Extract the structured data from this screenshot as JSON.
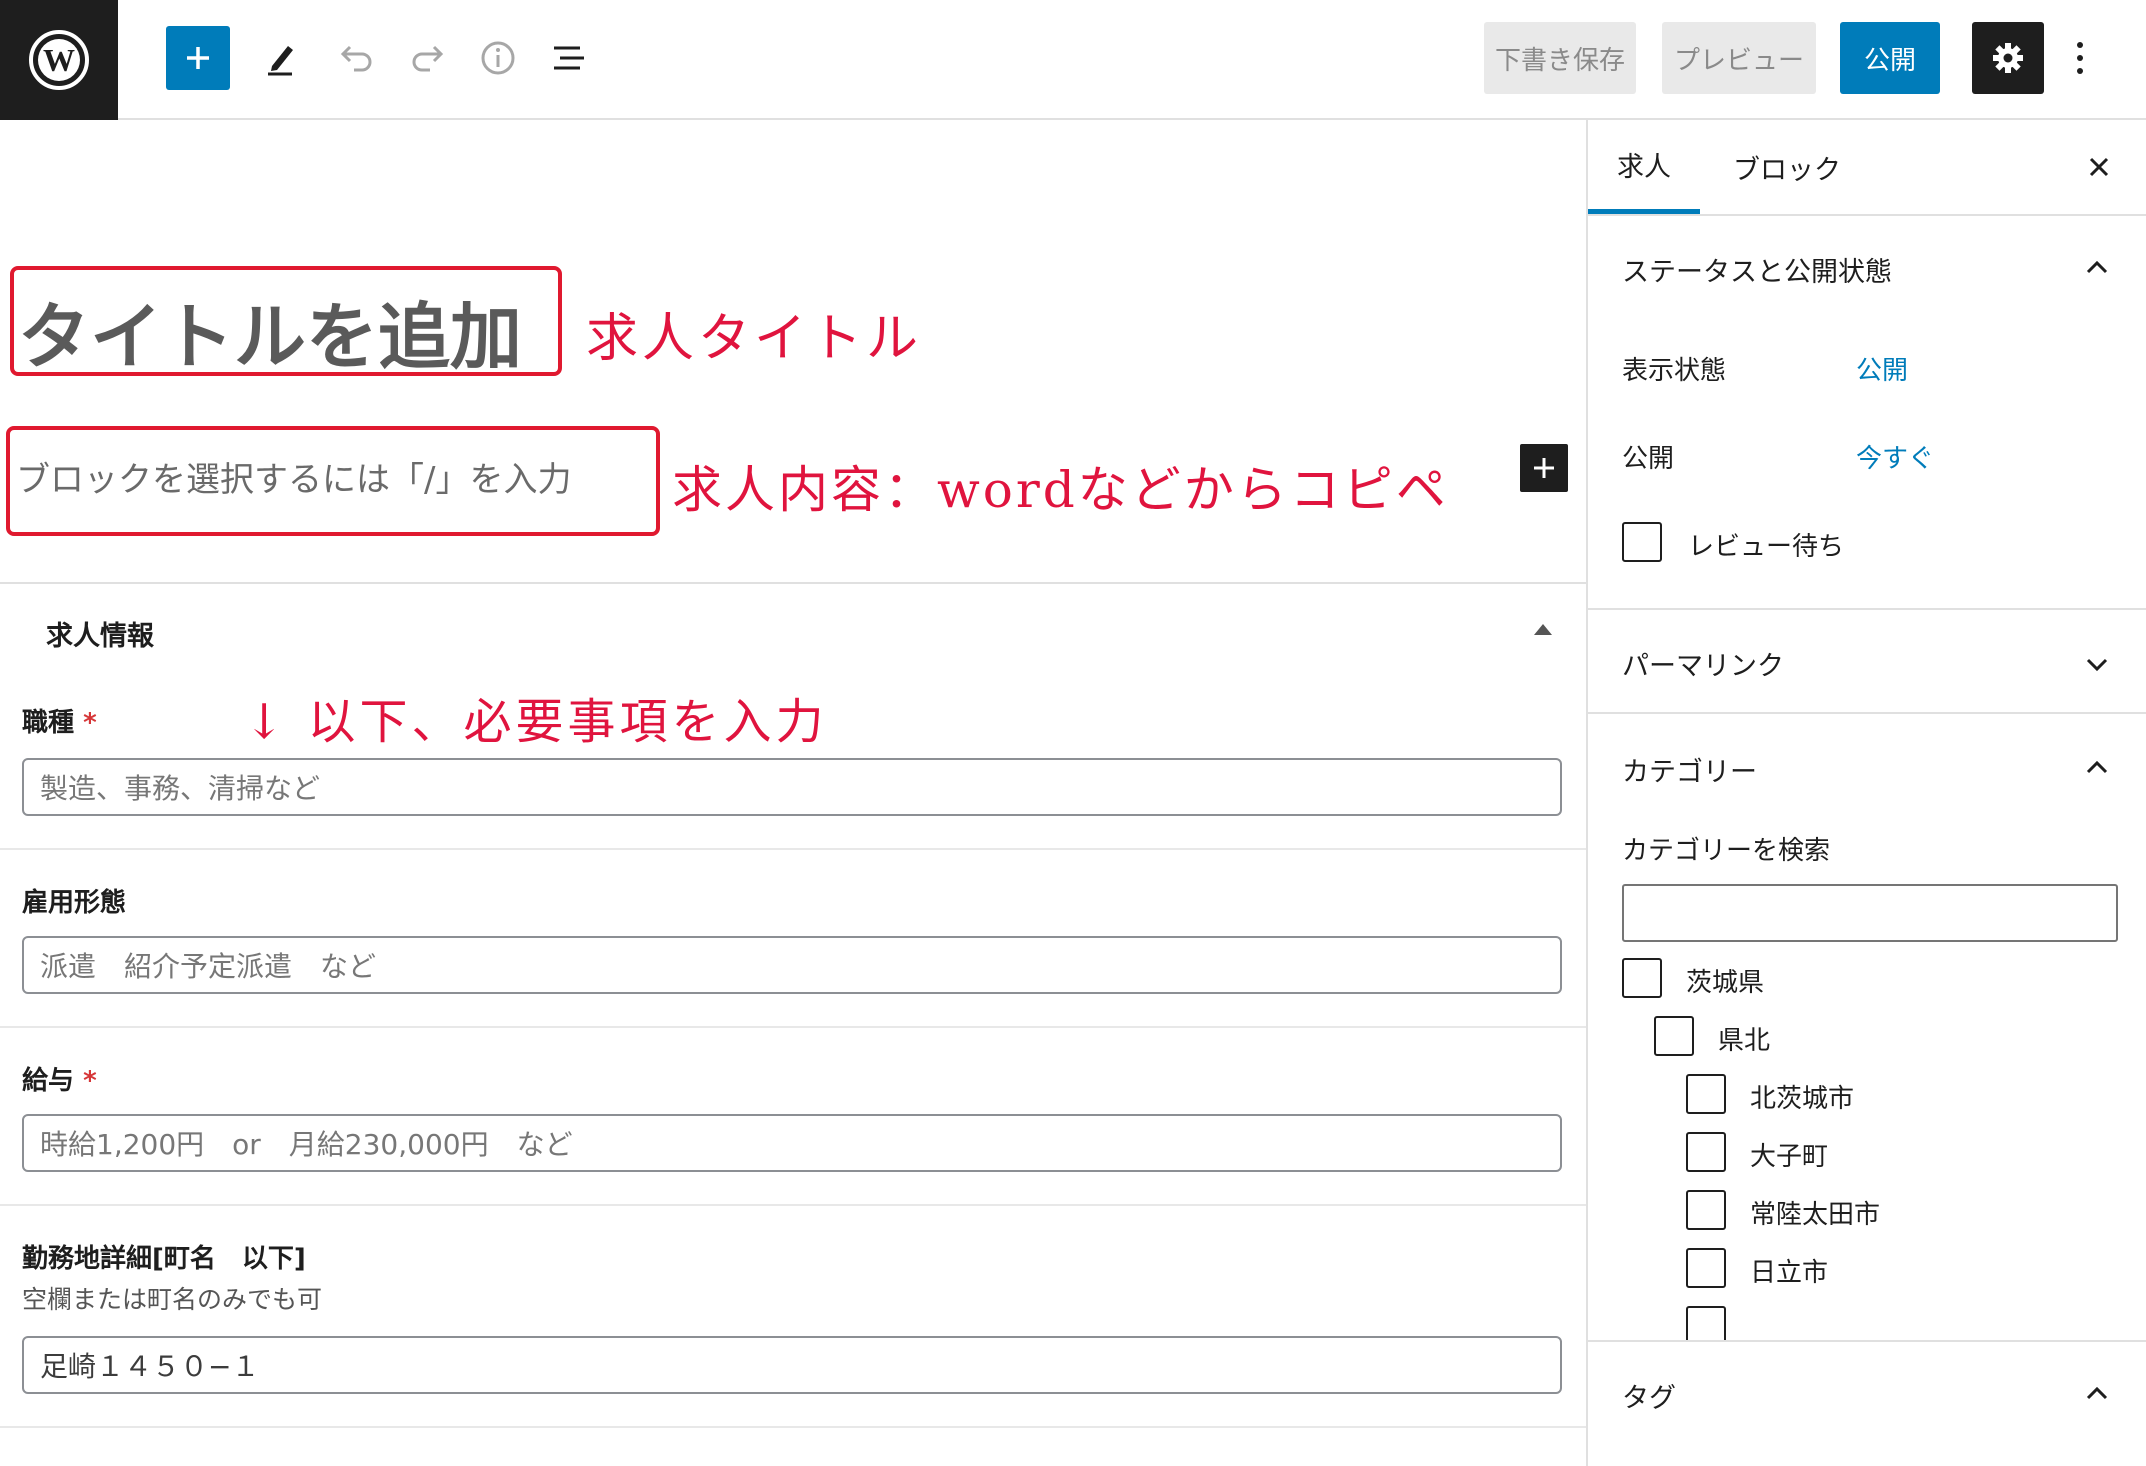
{
  "toolbar": {
    "save_draft_label": "下書き保存",
    "preview_label": "プレビュー",
    "publish_label": "公開",
    "icons": [
      "wordpress-logo",
      "plus-icon",
      "pencil-icon",
      "undo-icon",
      "redo-icon",
      "info-icon",
      "list-view-icon",
      "gear-icon",
      "more-vertical-icon"
    ]
  },
  "editor": {
    "title_placeholder": "タイトルを追加",
    "block_placeholder": "ブロックを選択するには「/」を入力",
    "annotations": {
      "title": "求人タイトル",
      "content": "求人内容：wordなどからコピペ",
      "fields": "↓ 以下、必要事項を入力"
    }
  },
  "metabox": {
    "title": "求人情報",
    "fields": [
      {
        "label": "職種",
        "required": "*",
        "placeholder": "製造、事務、清掃など"
      },
      {
        "label": "雇用形態",
        "placeholder": "派遣　紹介予定派遣　など"
      },
      {
        "label": "給与",
        "required": "*",
        "placeholder": "時給1,200円　or　月給230,000円　など"
      },
      {
        "label": "勤務地詳細[町名　以下]",
        "description": "空欄または町名のみでも可",
        "value": "足崎１４５０−１"
      }
    ]
  },
  "sidebar": {
    "tabs": [
      "求人",
      "ブロック"
    ],
    "status_section": {
      "title": "ステータスと公開状態",
      "visibility_label": "表示状態",
      "visibility_value": "公開",
      "publish_label": "公開",
      "publish_value": "今すぐ",
      "pending_review_label": "レビュー待ち"
    },
    "permalink_title": "パーマリンク",
    "category_section": {
      "title": "カテゴリー",
      "search_label": "カテゴリーを検索",
      "search_value": "",
      "items": [
        "茨城県",
        "県北",
        "北茨城市",
        "大子町",
        "常陸太田市",
        "日立市"
      ]
    },
    "tags_title": "タグ"
  },
  "colors": {
    "accent": "#007cba",
    "annotation": "#e0143e",
    "toolbar_dark": "#1e1e1e"
  }
}
